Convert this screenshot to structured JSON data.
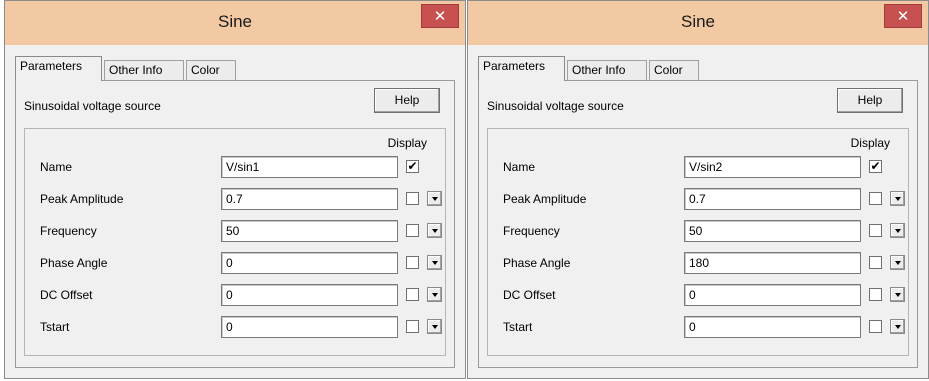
{
  "dialogs": [
    {
      "title": "Sine",
      "close_glyph": "✕",
      "tabs": [
        "Parameters",
        "Other Info",
        "Color"
      ],
      "description": "Sinusoidal voltage source",
      "help_label": "Help",
      "display_header": "Display",
      "fields": [
        {
          "label": "Name",
          "value": "V/sin1",
          "display_checked": true,
          "has_dropdown": false
        },
        {
          "label": "Peak Amplitude",
          "value": "0.7",
          "display_checked": false,
          "has_dropdown": true
        },
        {
          "label": "Frequency",
          "value": "50",
          "display_checked": false,
          "has_dropdown": true
        },
        {
          "label": "Phase Angle",
          "value": "0",
          "display_checked": false,
          "has_dropdown": true
        },
        {
          "label": "DC Offset",
          "value": "0",
          "display_checked": false,
          "has_dropdown": true
        },
        {
          "label": "Tstart",
          "value": "0",
          "display_checked": false,
          "has_dropdown": true
        }
      ]
    },
    {
      "title": "Sine",
      "close_glyph": "✕",
      "tabs": [
        "Parameters",
        "Other Info",
        "Color"
      ],
      "description": "Sinusoidal voltage source",
      "help_label": "Help",
      "display_header": "Display",
      "fields": [
        {
          "label": "Name",
          "value": "V/sin2",
          "display_checked": true,
          "has_dropdown": false
        },
        {
          "label": "Peak Amplitude",
          "value": "0.7",
          "display_checked": false,
          "has_dropdown": true
        },
        {
          "label": "Frequency",
          "value": "50",
          "display_checked": false,
          "has_dropdown": true
        },
        {
          "label": "Phase Angle",
          "value": "180",
          "display_checked": false,
          "has_dropdown": true
        },
        {
          "label": "DC Offset",
          "value": "0",
          "display_checked": false,
          "has_dropdown": true
        },
        {
          "label": "Tstart",
          "value": "0",
          "display_checked": false,
          "has_dropdown": true
        }
      ]
    }
  ],
  "colors": {
    "titlebar": "#f2c9a3",
    "close_button": "#c75050",
    "dialog_bg": "#f0f0f0"
  },
  "check_glyph": "✔"
}
